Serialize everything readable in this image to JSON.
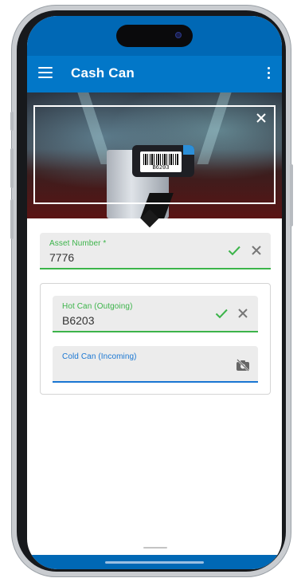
{
  "app": {
    "title": "Cash Can"
  },
  "scanner": {
    "barcode_value": "B6203"
  },
  "asset_field": {
    "label": "Asset Number *",
    "value": "7776"
  },
  "hot_can_field": {
    "label": "Hot Can (Outgoing)",
    "value": "B6203"
  },
  "cold_can_field": {
    "label": "Cold Can (Incoming)",
    "value": ""
  },
  "colors": {
    "primary": "#0277c8",
    "statusbar": "#0068b5",
    "success": "#3cb44a",
    "active_underline": "#1976d2",
    "field_bg": "#ececec"
  },
  "icons": {
    "menu": "menu-icon",
    "more": "more-vert-icon",
    "scanner_close": "close-icon",
    "valid": "check-icon",
    "clear": "close-icon",
    "camera_off": "camera-off-icon"
  }
}
